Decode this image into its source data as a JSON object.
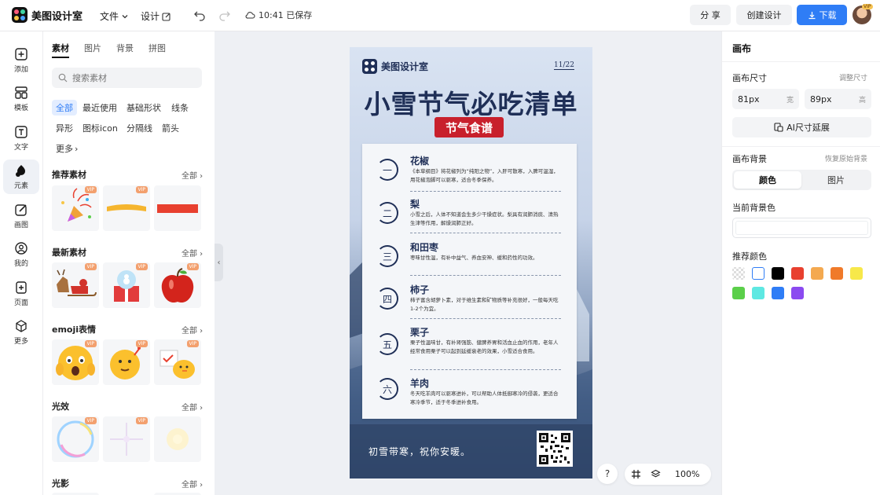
{
  "app": {
    "name": "美图设计室"
  },
  "topbar": {
    "file_menu": "文件",
    "design_menu": "设计",
    "save_status": "10:41 已保存",
    "share_label": "分 享",
    "create_label": "创建设计",
    "download_label": "下载",
    "avatar_badge": "VIP"
  },
  "rail": [
    {
      "label": "添加",
      "icon": "plus-square-icon"
    },
    {
      "label": "模板",
      "icon": "template-icon"
    },
    {
      "label": "文字",
      "icon": "text-icon"
    },
    {
      "label": "元素",
      "icon": "shapes-icon"
    },
    {
      "label": "画图",
      "icon": "draw-icon"
    },
    {
      "label": "我的",
      "icon": "user-icon"
    },
    {
      "label": "页面",
      "icon": "add-page-icon"
    },
    {
      "label": "更多",
      "icon": "cube-icon"
    }
  ],
  "panel": {
    "tabs": [
      "素材",
      "图片",
      "背景",
      "拼图"
    ],
    "search_placeholder": "搜索素材",
    "chips": [
      "全部",
      "最近使用",
      "基础形状",
      "线条",
      "异形",
      "图标icon",
      "分隔线",
      "箭头",
      "更多"
    ],
    "sections": [
      {
        "title": "推荐素材",
        "all": "全部"
      },
      {
        "title": "最新素材",
        "all": "全部"
      },
      {
        "title": "emoji表情",
        "all": "全部"
      },
      {
        "title": "光效",
        "all": "全部"
      },
      {
        "title": "光影",
        "all": "全部"
      }
    ],
    "vip": "VIP"
  },
  "poster": {
    "brand": "美图设计室",
    "date": "11/22",
    "title": "小雪节气必吃清单",
    "badge": "节气食谱",
    "items": [
      {
        "num": "一",
        "name": "花椒",
        "desc": "《本草纲目》将花椒列为“纯阳之物”，入肝可散寒，入脾可温湿，用花椒泡脚可以驱寒，适合冬季保养。"
      },
      {
        "num": "二",
        "name": "梨",
        "desc": "小雪之后，人体不知道会生多少干燥症状。梨具有润肺消痰、清热生津等作用，解燥润肺正好。"
      },
      {
        "num": "三",
        "name": "和田枣",
        "desc": "枣味甘性温，有补中益气、养血安神、缓和药性的功效。"
      },
      {
        "num": "四",
        "name": "柿子",
        "desc": "柿子富含胡萝卜素，对于维生素和矿物质等补充很好，一般每天吃1-2个为宜。"
      },
      {
        "num": "五",
        "name": "栗子",
        "desc": "栗子性温味甘，有补肾强筋、健脾养胃和活血止血的作用，老年人经常食用栗子可以起到延缓衰老的效果，小雪适合食用。"
      },
      {
        "num": "六",
        "name": "羊肉",
        "desc": "冬天吃羊肉可以驱寒进补，可以帮助人体抵御寒冷的侵袭，更适合寒冷季节，适于冬季进补食用。"
      }
    ],
    "footer": "初雪带寒，祝你安暖。"
  },
  "canvas_tools": {
    "help": "?",
    "zoom": "100%"
  },
  "right_panel": {
    "title": "画布",
    "size_label": "画布尺寸",
    "size_link": "调整尺寸",
    "width_value": "81px",
    "width_unit": "宽",
    "height_value": "89px",
    "height_unit": "高",
    "ai_button": "AI尺寸延展",
    "bg_label": "画布背景",
    "bg_reset": "恢复原始背景",
    "seg_color": "颜色",
    "seg_image": "图片",
    "current_bg_label": "当前背景色",
    "recommended_label": "推荐颜色",
    "swatches": [
      "transparent",
      "#ffffff",
      "#000000",
      "#e8402f",
      "#f4a950",
      "#f07a2a",
      "#f7e84a",
      "#5bcf4a",
      "#5ee8e2",
      "#2f7df6",
      "#8b4af0"
    ]
  }
}
